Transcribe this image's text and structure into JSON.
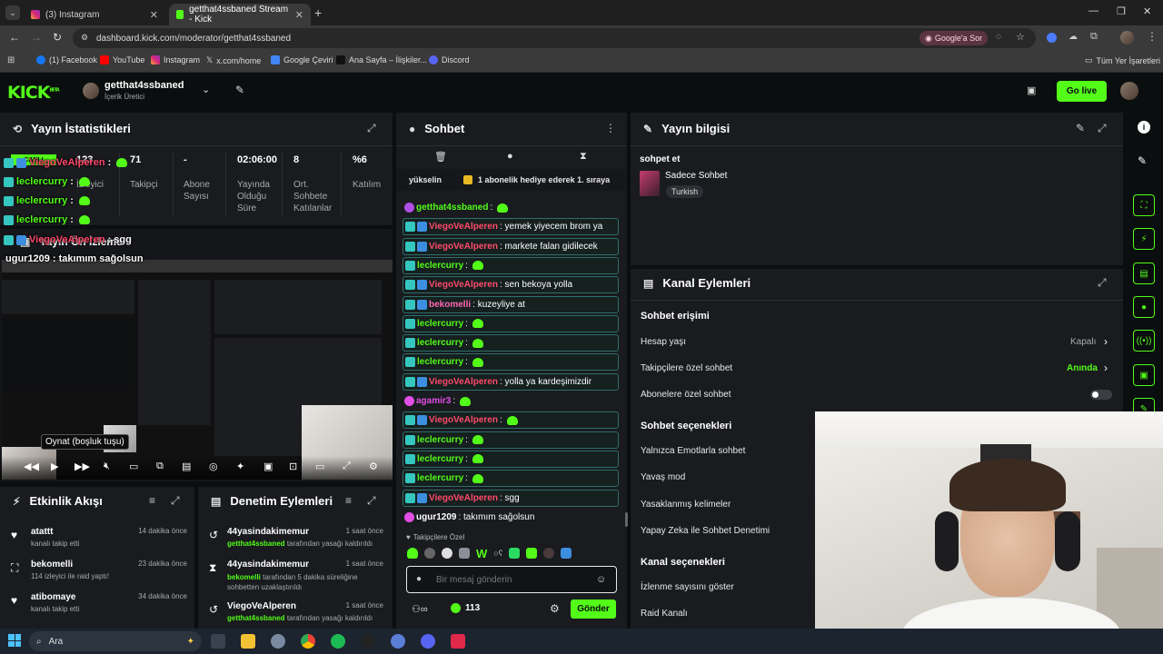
{
  "browser": {
    "tabs": [
      {
        "label": "(3) Instagram"
      },
      {
        "label": "getthat4ssbaned Stream - Kick"
      }
    ],
    "url": "dashboard.kick.com/moderator/getthat4ssbaned",
    "google_ask": "Google'a Sor",
    "bookmarks": [
      "(1) Facebook",
      "YouTube",
      "Instagram",
      "x.com/home",
      "Google Çeviri",
      "Ana Sayfa – İlişkiler...",
      "Discord"
    ],
    "all_bookmarks": "Tüm Yer İşaretleri"
  },
  "header": {
    "logo": "KICK",
    "logo_beta": "BETA",
    "channel_name": "getthat4ssbaned",
    "role": "İçerik Üretici",
    "go_live": "Go live"
  },
  "stats": {
    "title": "Yayın İstatistikleri",
    "items": [
      {
        "value": "123",
        "label": "İzleyici"
      },
      {
        "value": "71",
        "label": "Takipçi"
      },
      {
        "value": "-",
        "label": "Abone Sayısı"
      },
      {
        "value": "02:06:00",
        "label": "Yayında Olduğu Süre"
      },
      {
        "value": "8",
        "label": "Ort. Sohbete Katılanlar"
      },
      {
        "value": "%6",
        "label": "Katılım"
      }
    ],
    "live_badge": "CANLI"
  },
  "preview": {
    "title": "Yayın Ön İzleme",
    "tooltip": "Oynat (boşluk tuşu)"
  },
  "overlay_chat": [
    {
      "user": "ViegoVeAlperen",
      "text": ":"
    },
    {
      "user": "leclercurry",
      "text": ":"
    },
    {
      "user": "leclercurry",
      "text": ":"
    },
    {
      "user": "leclercurry",
      "text": ":"
    },
    {
      "user": "ViegoVeAlperen",
      "text": ": sgg"
    },
    {
      "user": "ugur1209",
      "text": ": takımım sağolsun"
    }
  ],
  "chat": {
    "title": "Sohbet",
    "pinned_left": "yükselin",
    "pinned_right": "1 abonelik hediye ederek 1. sıraya",
    "messages": [
      {
        "user": "getthat4ssbaned",
        "text": ":",
        "emote": true,
        "style": "owner"
      },
      {
        "user": "ViegoVeAlperen",
        "text": ": yemek yiyecem brom ya",
        "emote": false
      },
      {
        "user": "ViegoVeAlperen",
        "text": ": markete falan gidilecek",
        "emote": false
      },
      {
        "user": "leclercurry",
        "text": ":",
        "emote": true
      },
      {
        "user": "ViegoVeAlperen",
        "text": ": sen bekoya yolla",
        "emote": false
      },
      {
        "user": "bekomelli",
        "text": ": kuzeyliye at",
        "emote": false
      },
      {
        "user": "leclercurry",
        "text": ":",
        "emote": true
      },
      {
        "user": "leclercurry",
        "text": ":",
        "emote": true
      },
      {
        "user": "leclercurry",
        "text": ":",
        "emote": true
      },
      {
        "user": "ViegoVeAlperen",
        "text": ": yolla ya kardeşimizdir",
        "emote": false
      },
      {
        "user": "agamir3",
        "text": ":",
        "emote": true,
        "style": "plain"
      },
      {
        "user": "ViegoVeAlperen",
        "text": ":",
        "emote": true
      },
      {
        "user": "leclercurry",
        "text": ":",
        "emote": true
      },
      {
        "user": "leclercurry",
        "text": ":",
        "emote": true
      },
      {
        "user": "leclercurry",
        "text": ":",
        "emote": true
      },
      {
        "user": "ViegoVeAlperen",
        "text": ": sgg",
        "emote": false
      },
      {
        "user": "ugur1209",
        "text": ": takımım sağolsun",
        "emote": false,
        "style": "plain"
      }
    ],
    "followers_only": "Takipçilere Özel",
    "input_placeholder": "Bir mesaj gönderin",
    "points": "113",
    "send": "Gönder"
  },
  "stream_info": {
    "title": "Yayın bilgisi",
    "stream_title": "sohpet et",
    "category": "Sadece Sohbet",
    "language": "Turkish"
  },
  "channel_actions": {
    "title": "Kanal Eylemleri",
    "sections": [
      {
        "label": "Sohbet erişimi"
      },
      {
        "label": "Sohbet seçenekleri"
      },
      {
        "label": "Kanal seçenekleri"
      }
    ],
    "rows": [
      {
        "label": "Hesap yaşı",
        "value": "Kapalı"
      },
      {
        "label": "Takipçilere özel sohbet",
        "value": "Anında"
      },
      {
        "label": "Abonelere özel sohbet",
        "value": ""
      },
      {
        "label": "Yalnızca Emotlarla sohbet",
        "value": ""
      },
      {
        "label": "Yavaş mod",
        "value": ""
      },
      {
        "label": "Yasaklanmış kelimeler",
        "value": ""
      },
      {
        "label": "Yapay Zeka ile Sohbet Denetimi",
        "value": ""
      },
      {
        "label": "İzlenme sayısını göster",
        "value": ""
      },
      {
        "label": "Raid Kanalı",
        "value": ""
      }
    ]
  },
  "activity": {
    "title": "Etkinlik Akışı",
    "events": [
      {
        "user": "atattt",
        "desc": "kanalı takip etti",
        "time": "14 dakika önce"
      },
      {
        "user": "bekomelli",
        "desc": "114 izleyici ile raid yaptı!",
        "time": "23 dakika önce"
      },
      {
        "user": "atibomaye",
        "desc": "kanalı takip etti",
        "time": "34 dakika önce"
      }
    ]
  },
  "moderation": {
    "title": "Denetim Eylemleri",
    "events": [
      {
        "user": "44yasindakimemur",
        "actor": "getthat4ssbaned",
        "desc": "tarafından yasağı kaldırıldı",
        "time": "1 saat önce"
      },
      {
        "user": "44yasindakimemur",
        "actor": "bekomelli",
        "desc": "tarafından 5 dakika süreliğine sohbetten uzaklaştırıldı",
        "time": "1 saat önce"
      },
      {
        "user": "ViegoVeAlperen",
        "actor": "getthat4ssbaned",
        "desc": "tarafından yasağı kaldırıldı",
        "time": "1 saat önce"
      }
    ]
  },
  "taskbar": {
    "search": "Ara"
  }
}
